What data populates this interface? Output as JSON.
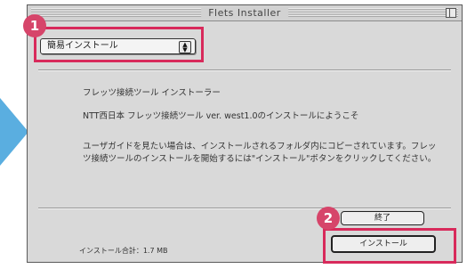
{
  "window": {
    "title": "Flets Installer"
  },
  "popup": {
    "selected": "簡易インストール"
  },
  "content": {
    "line1": "フレッツ接続ツール インストーラー",
    "line2": "NTT西日本 フレッツ接続ツール ver. west1.0のインストールにようこそ",
    "line3": "ユーザガイドを見たい場合は、インストールされるフォルダ内にコピーされています。フレッツ接続ツールのインストールを開始するには\"インストール\"ボタンをクリックしてください。"
  },
  "footer": {
    "size_label": "インストール合計：1.7 MB"
  },
  "buttons": {
    "exit": "終了",
    "install": "インストール"
  },
  "badges": {
    "step1": "1",
    "step2": "2"
  },
  "colors": {
    "highlight": "#d82a5b",
    "arrow": "#5aaee0"
  }
}
